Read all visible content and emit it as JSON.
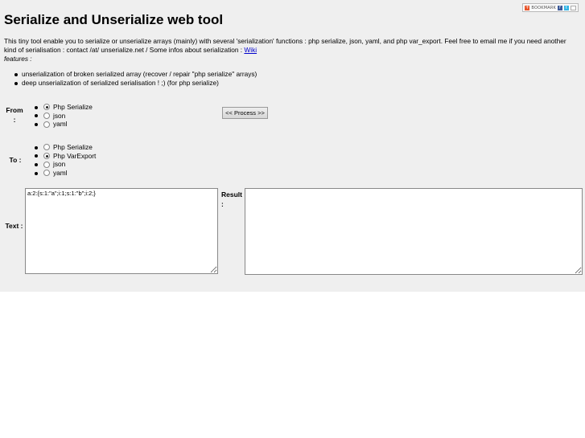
{
  "header": {
    "title": "Serialize and Unserialize web tool",
    "bookmark_label": "BOOKMARK"
  },
  "intro": {
    "text_before_link": "This tiny tool enable you to serialize or unserialize arrays (mainly) with several 'serialization' functions : php serialize, json, yaml, and php var_export. Feel free to email me if you need another kind of serialisation : contact /at/ unserialize.net / Some infos about serialization : ",
    "link_text": "Wiki"
  },
  "features": {
    "label": "features :",
    "items": [
      "unserialization of broken serialized array (recover / repair \"php serialize\" arrays)",
      "deep unserialization of serialized serialisation ! ;) (for php serialize)"
    ]
  },
  "from": {
    "label": "From :",
    "options": [
      {
        "label": "Php Serialize",
        "checked": true
      },
      {
        "label": "json",
        "checked": false
      },
      {
        "label": "yaml",
        "checked": false
      }
    ]
  },
  "process_button": "<< Process >>",
  "to": {
    "label": "To :",
    "options": [
      {
        "label": "Php Serialize",
        "checked": false
      },
      {
        "label": "Php VarExport",
        "checked": true
      },
      {
        "label": "json",
        "checked": false
      },
      {
        "label": "yaml",
        "checked": false
      }
    ]
  },
  "text_field": {
    "label": "Text :",
    "value": "a:2:{s:1:\"a\";i:1;s:1:\"b\";i:2;}"
  },
  "result_field": {
    "label": "Result :",
    "value": ""
  }
}
